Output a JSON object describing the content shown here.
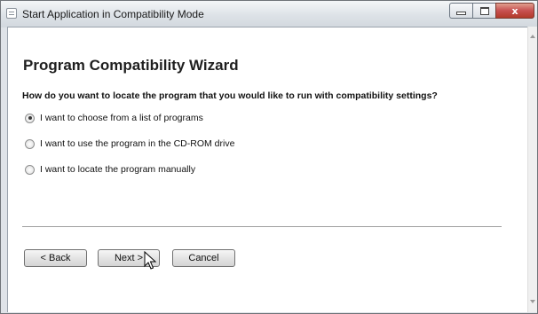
{
  "window": {
    "title": "Start Application in Compatibility Mode",
    "minimize_label": "",
    "close_label": "x"
  },
  "wizard": {
    "heading": "Program Compatibility Wizard",
    "question": "How do you want to locate the program that you would like to run with compatibility settings?",
    "options": [
      {
        "label": "I want to choose from a list of programs",
        "selected": true
      },
      {
        "label": "I want to use the program in the CD-ROM drive",
        "selected": false
      },
      {
        "label": "I want to locate the program manually",
        "selected": false
      }
    ]
  },
  "buttons": {
    "back": "< Back",
    "next": "Next >",
    "cancel": "Cancel"
  },
  "icons": {
    "app": "app-window-icon",
    "cursor": "mouse-pointer-icon"
  }
}
